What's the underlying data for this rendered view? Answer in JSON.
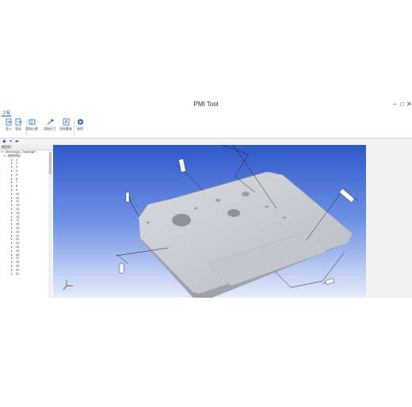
{
  "window": {
    "title": "PMI Tool",
    "controls": {
      "minimize": "–",
      "maximize": "□",
      "close": "✕"
    }
  },
  "ribbon": {
    "tab": "工程",
    "buttons": [
      {
        "label": "导入",
        "icon": "import-icon"
      },
      {
        "label": "导出",
        "icon": "export-icon"
      },
      {
        "label": "添加公差",
        "icon": "add-tolerance-icon"
      },
      {
        "label": "添加尺寸",
        "icon": "add-dimension-icon"
      },
      {
        "label": "添加基准",
        "icon": "add-datum-icon"
      },
      {
        "label": "选项",
        "icon": "options-icon"
      }
    ]
  },
  "toolbar2": {
    "icons": [
      "view-icon",
      "link-icon",
      "display-icon"
    ]
  },
  "tree": {
    "header": "模型树",
    "root": "Metrologic_TrainingP...",
    "group": "结构特征",
    "items": [
      "1",
      "2",
      "3",
      "4",
      "5",
      "6",
      "7",
      "8",
      "9",
      "10",
      "11",
      "12",
      "13",
      "14",
      "15",
      "16",
      "17",
      "18",
      "19",
      "20",
      "21",
      "22",
      "23",
      "24",
      "25",
      "26",
      "27",
      "28",
      "29",
      "30",
      "31"
    ]
  },
  "colors": {
    "viewport_top": "#2f58c9",
    "viewport_bottom": "#e6ecfa",
    "part": "#c8cbd1",
    "accent": "#1b5eaa"
  }
}
